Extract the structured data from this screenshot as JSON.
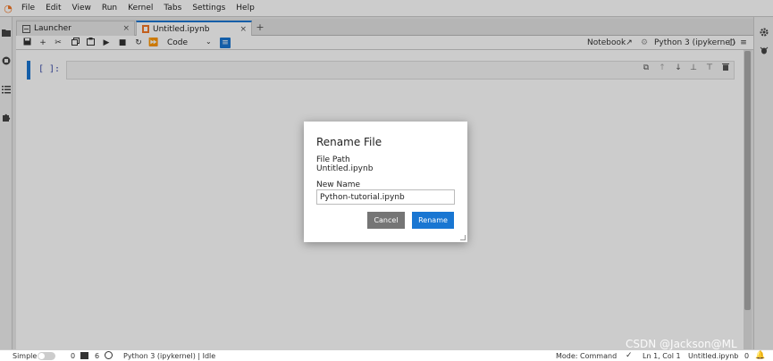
{
  "menubar": {
    "items": [
      "File",
      "Edit",
      "View",
      "Run",
      "Kernel",
      "Tabs",
      "Settings",
      "Help"
    ]
  },
  "tabs": [
    {
      "label": "Launcher",
      "icon": "launcher-icon",
      "close": "×"
    },
    {
      "label": "Untitled.ipynb",
      "icon": "notebook-icon",
      "close": "×"
    }
  ],
  "tab_add": "+",
  "toolbar": {
    "cell_type": "Code",
    "notebook_label": "Notebook",
    "kernel_label": "Python 3 (ipykernel)"
  },
  "cell": {
    "prompt": "[ ]:"
  },
  "dialog": {
    "title": "Rename File",
    "file_path_label": "File Path",
    "file_path_value": "Untitled.ipynb",
    "new_name_label": "New Name",
    "new_name_value": "Python-tutorial.ipynb",
    "cancel_label": "Cancel",
    "rename_label": "Rename"
  },
  "statusbar": {
    "mode_label": "Simple",
    "count_a": "0",
    "count_b": "6",
    "kernel_status": "Python 3 (ipykernel) | Idle",
    "mode_command": "Mode: Command",
    "cursor": "Ln 1, Col 1",
    "file": "Untitled.ipynb",
    "count_c": "0"
  },
  "watermark": "CSDN @Jackson@ML",
  "colors": {
    "accent": "#1976d2",
    "logo": "#f37726",
    "cancel": "#757575"
  }
}
